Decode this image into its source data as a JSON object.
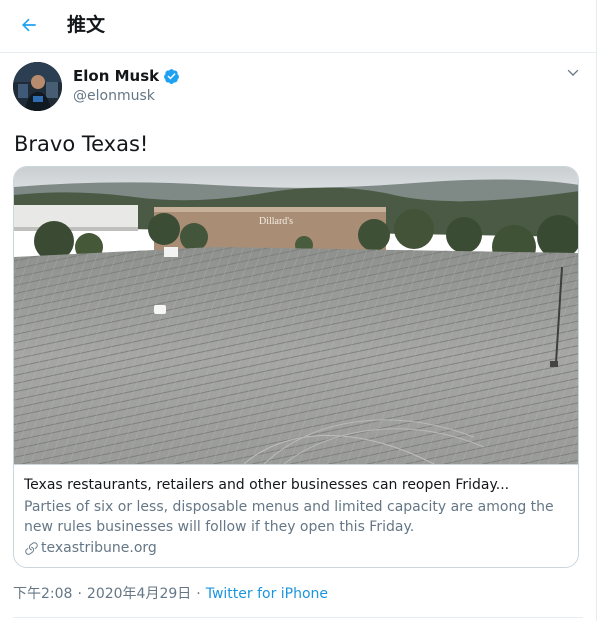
{
  "header": {
    "title": "推文",
    "back_icon": "arrow-left-icon"
  },
  "author": {
    "name": "Elon Musk",
    "handle": "@elonmusk",
    "verified_icon": "verified-badge-icon",
    "menu_icon": "chevron-down-icon"
  },
  "tweet": {
    "text": "Bravo Texas!"
  },
  "card": {
    "image_sign": "Dillard's",
    "title": "Texas restaurants, retailers and other businesses can reopen Friday...",
    "description": "Parties of six or less, disposable menus and limited capacity are among the new rules businesses will follow if they open this Friday.",
    "domain": "texastribune.org",
    "link_icon": "link-icon"
  },
  "meta": {
    "time": "下午2:08",
    "date": "2020年4月29日",
    "separator": "·",
    "source": "Twitter for iPhone"
  },
  "colors": {
    "accent": "#1da1f2",
    "link": "#1b95e0",
    "secondary_text": "#657786",
    "border": "#ccd6dd"
  }
}
